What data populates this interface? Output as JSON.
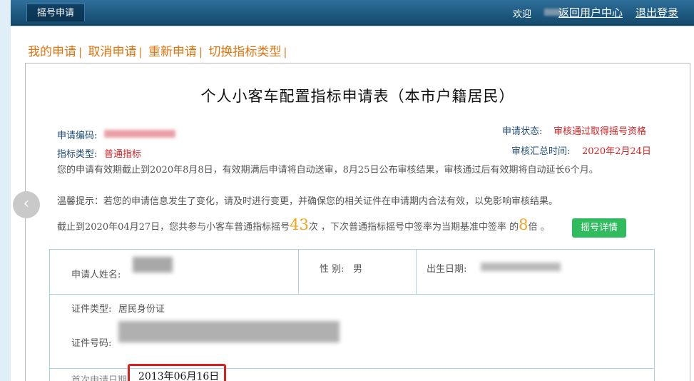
{
  "topbar": {
    "tab": "摇号申请",
    "welcome": "欢迎",
    "back_link": "返回用户中心",
    "logout_link": "退出登录"
  },
  "subnav": {
    "items": [
      "我的申请",
      "取消申请",
      "重新申请",
      "切换指标类型"
    ]
  },
  "form": {
    "title": "个人小客车配置指标申请表（本市户籍居民）",
    "app_no_label": "申请编码:",
    "index_type_label": "指标类型:",
    "index_type_value": "普通指标",
    "status_label": "申请状态:",
    "status_value": "审核通过取得摇号资格",
    "summary_time_label": "审核汇总时间:",
    "summary_time_value": "2020年2月24日",
    "validity_text": "您的申请有效期截止到2020年8月8日，有效期满后申请将自动送审，8月25日公布审核结果，审核通过后有效期将自动延长6个月。",
    "tip_text": "温馨提示：若您的申请信息发生了变化，请及时进行变更，并确保您的相关证件在申请期内合法有效，以免影响审核结果。",
    "count_pre": "截止到2020年04月27日，您共参与小客车普通指标摇号",
    "count_value": "43",
    "count_mid": "次 ，下次普通指标摇号中签率为当期基准中签率 的",
    "multiple_value": "8",
    "count_post": "倍 。",
    "details_button": "摇号详情"
  },
  "table": {
    "name_label": "申请人姓名:",
    "gender_label": "性 别:",
    "gender_value": "男",
    "birth_label": "出生日期:",
    "id_type_label": "证件类型:",
    "id_type_value": "居民身份证",
    "id_no_label": "证件号码:",
    "first_apply_label": "首次申请日期:",
    "first_apply_value": "2013年06月16日"
  },
  "nav": {
    "prev_arrow": "‹"
  }
}
